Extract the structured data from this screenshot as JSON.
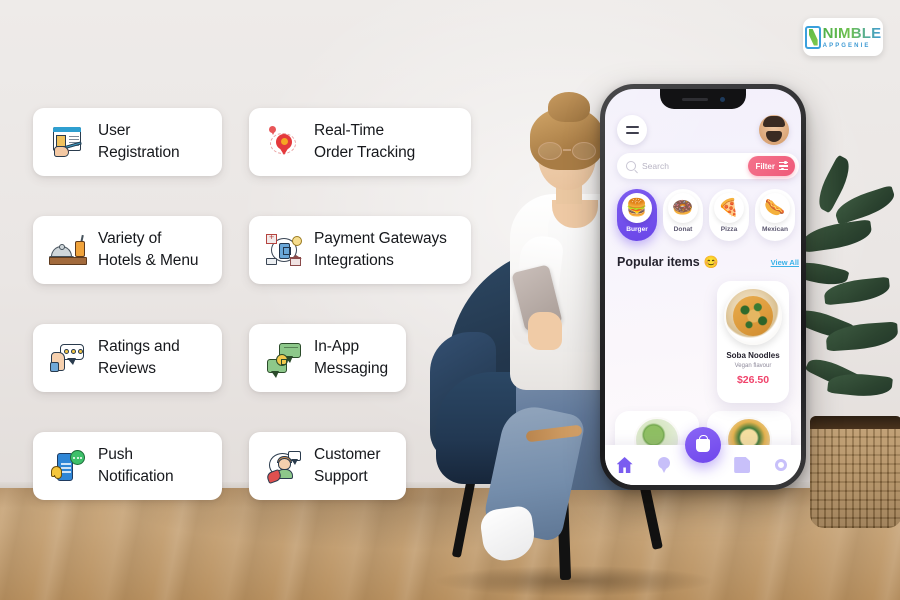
{
  "logo": {
    "name": "NIMBLE",
    "tagline": "APPGENIE",
    "mark_icon": "mobile-phone-icon",
    "colors": {
      "green": "#5fbb46",
      "blue": "#3f9bd4"
    }
  },
  "features": [
    {
      "id": "user-registration",
      "icon": "id-card-registration-icon",
      "label": "User\nRegistration"
    },
    {
      "id": "real-time-order-tracking",
      "icon": "map-pin-route-icon",
      "label": "Real-Time\nOrder Tracking"
    },
    {
      "id": "variety-of-hotels-menu",
      "icon": "food-cloche-drink-icon",
      "label": "Variety of\nHotels & Menu"
    },
    {
      "id": "payment-gateways-integrations",
      "icon": "payment-network-icon",
      "label": "Payment Gateways\nIntegrations"
    },
    {
      "id": "ratings-and-reviews",
      "icon": "thumbs-up-chat-icon",
      "label": "Ratings and\nReviews"
    },
    {
      "id": "in-app-messaging",
      "icon": "secure-chat-bubbles-icon",
      "label": "In-App\nMessaging"
    },
    {
      "id": "push-notification",
      "icon": "phone-bell-alert-icon",
      "label": "Push\nNotification"
    },
    {
      "id": "customer-support",
      "icon": "support-agent-headset-icon",
      "label": "Customer\nSupport"
    }
  ],
  "phone_mockup": {
    "header": {
      "menu_icon": "hamburger-menu-icon",
      "avatar_icon": "user-avatar-icon"
    },
    "search": {
      "placeholder": "Search",
      "icon": "search-icon"
    },
    "filter": {
      "label": "Filter",
      "icon": "filter-sliders-icon",
      "color": "#ef5a79"
    },
    "categories": [
      {
        "name": "Burger",
        "emoji": "🍔",
        "active": true
      },
      {
        "name": "Donat",
        "emoji": "🍩",
        "active": false
      },
      {
        "name": "Pizza",
        "emoji": "🍕",
        "active": false
      },
      {
        "name": "Mexican",
        "emoji": "🌭",
        "active": false
      }
    ],
    "section": {
      "title": "Popular items",
      "title_emoji": "😊",
      "view_all": "View All",
      "view_all_color": "#39b2e8"
    },
    "featured_item": {
      "name": "Soba Noodles",
      "flavour": "Vegan flavour",
      "flavour_emoji": "🥦",
      "price": "$26.50",
      "price_color": "#f0436b"
    },
    "tabbar": {
      "items": [
        {
          "name": "home",
          "icon": "home-icon",
          "active": true
        },
        {
          "name": "location",
          "icon": "map-pin-icon",
          "active": false
        },
        {
          "name": "orders",
          "icon": "document-icon",
          "active": false
        },
        {
          "name": "settings",
          "icon": "gear-icon",
          "active": false
        }
      ],
      "fab": {
        "name": "cart",
        "icon": "shopping-bag-icon",
        "color": "#6f46ec"
      }
    },
    "accent_color": "#7a5cf0"
  },
  "scene": {
    "background_color": "#ece9e7",
    "floor_color": "#c7a478",
    "chair_color": "#23374d",
    "plant_icon": "potted-plant",
    "person_icon": "woman-sitting-with-phone"
  }
}
